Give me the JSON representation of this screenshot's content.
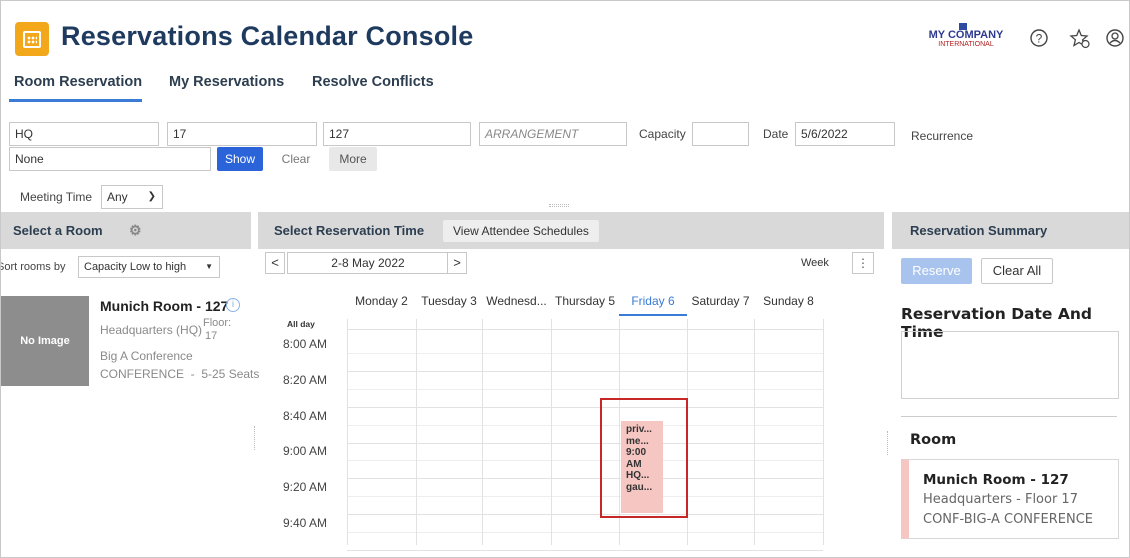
{
  "app": {
    "title": "Reservations Calendar Console",
    "logo_line1": "MY COMPANY",
    "logo_line2": "INTERNATIONAL"
  },
  "header_icons": [
    "help-icon",
    "favorites-icon",
    "user-icon"
  ],
  "tabs": [
    {
      "label": "Room Reservation",
      "active": true
    },
    {
      "label": "My Reservations",
      "active": false
    },
    {
      "label": "Resolve Conflicts",
      "active": false
    }
  ],
  "filters": {
    "building": "HQ",
    "floor": "17",
    "room": "127",
    "arrangement_placeholder": "ARRANGEMENT",
    "capacity_label": "Capacity",
    "capacity_value": "",
    "date_label": "Date",
    "date_value": "5/6/2022",
    "recurrence_label": "Recurrence",
    "recurrence_value": "None",
    "show_label": "Show",
    "clear_label": "Clear",
    "more_label": "More",
    "meeting_time_label": "Meeting Time",
    "meeting_time_value": "Any"
  },
  "left_panel": {
    "title": "Select a Room",
    "sort_label": "Sort rooms by",
    "sort_value": "Capacity Low to high",
    "room": {
      "thumb_text": "No Image",
      "name": "Munich Room - 127",
      "building": "Headquarters (HQ)",
      "floor_label": "Floor:",
      "floor_value": "17",
      "arrangement": "Big A Conference",
      "type_capacity": "CONFERENCE  -  5-25 Seats"
    }
  },
  "calendar": {
    "title": "Select Reservation Time",
    "attendee_button": "View Attendee Schedules",
    "prev": "<",
    "next": ">",
    "range": "2-8 May 2022",
    "view_label": "Week",
    "days": [
      "Monday 2",
      "Tuesday 3",
      "Wednesd...",
      "Thursday 5",
      "Friday 6",
      "Saturday 7",
      "Sunday 8"
    ],
    "today_index": 4,
    "allday_label": "All day",
    "times": [
      "8:00 AM",
      "8:20 AM",
      "8:40 AM",
      "9:00 AM",
      "9:20 AM",
      "9:40 AM"
    ],
    "event": {
      "lines": [
        "priv...",
        "me...",
        "9:00",
        "AM",
        "HQ...",
        "gau..."
      ]
    }
  },
  "right_panel": {
    "title": "Reservation Summary",
    "reserve_label": "Reserve",
    "clear_all_label": "Clear All",
    "date_time_title": "Reservation Date And Time",
    "room_title": "Room",
    "room_card": {
      "name": "Munich Room - 127",
      "location": "Headquarters - Floor 17",
      "type": "CONF-BIG-A CONFERENCE"
    }
  }
}
